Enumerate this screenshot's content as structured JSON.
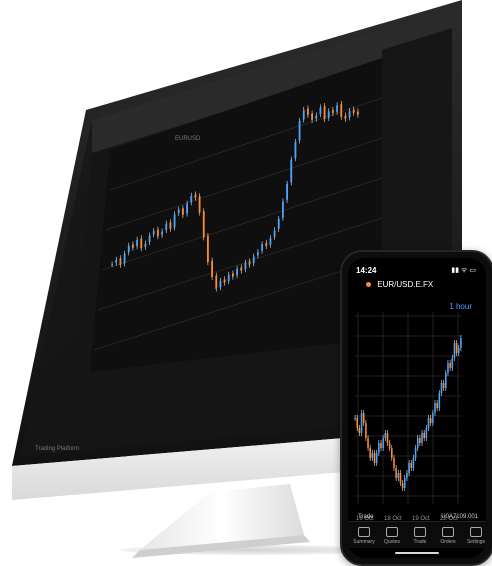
{
  "desktop": {
    "app": {
      "instrument_label": "EURUSD",
      "footer": "Trading Platform"
    }
  },
  "phone": {
    "time": "14:24",
    "instrument": "EUR/USD.E.FX",
    "interval": "1 hour",
    "trade_label": "Trade",
    "account_id": "U0A7109.001",
    "tabs": [
      "Summary",
      "Quotes",
      "Trade",
      "Orders",
      "Settings"
    ],
    "x_labels": [
      "16 Oct",
      "18 Oct",
      "19 Oct",
      "22 Oct"
    ]
  },
  "colors": {
    "up": "#4aa3ff",
    "down": "#ff8a2b",
    "neutral": "#e7e7e7"
  },
  "chart_data": [
    {
      "type": "line",
      "title": "",
      "x": [
        0,
        1,
        2,
        3,
        4,
        5,
        6,
        7,
        8,
        9,
        10,
        11,
        12,
        13,
        14,
        15,
        16,
        17,
        18,
        19,
        20,
        21,
        22,
        23,
        24,
        25,
        26,
        27,
        28,
        29,
        30,
        31,
        32,
        33,
        34,
        35,
        36,
        37,
        38,
        39,
        40,
        41,
        42,
        43,
        44,
        45,
        46,
        47,
        48,
        49,
        50,
        51,
        52,
        53,
        54,
        55,
        56,
        57,
        58,
        59
      ],
      "series": [
        {
          "values": [
            1.161,
            1.162,
            1.16,
            1.163,
            1.165,
            1.164,
            1.166,
            1.163,
            1.164,
            1.166,
            1.167,
            1.165,
            1.166,
            1.168,
            1.166,
            1.17,
            1.171,
            1.169,
            1.172,
            1.174,
            1.173,
            1.168,
            1.16,
            1.152,
            1.147,
            1.143,
            1.145,
            1.144,
            1.146,
            1.145,
            1.147,
            1.146,
            1.148,
            1.147,
            1.149,
            1.15,
            1.152,
            1.151,
            1.153,
            1.155,
            1.158,
            1.163,
            1.168,
            1.175,
            1.18,
            1.186,
            1.189,
            1.187,
            1.185,
            1.186,
            1.188,
            1.184,
            1.186,
            1.185,
            1.187,
            1.183,
            1.182,
            1.184,
            1.183,
            1.182
          ]
        }
      ]
    },
    {
      "type": "line",
      "title": "",
      "x": [
        0,
        1,
        2,
        3,
        4,
        5,
        6,
        7,
        8,
        9,
        10,
        11,
        12,
        13,
        14,
        15,
        16,
        17,
        18,
        19,
        20,
        21,
        22,
        23,
        24,
        25,
        26,
        27,
        28,
        29,
        30,
        31,
        32,
        33,
        34,
        35,
        36,
        37,
        38,
        39,
        40,
        41,
        42,
        43,
        44,
        45,
        46,
        47,
        48,
        49
      ],
      "series": [
        {
          "values": [
            1.155,
            1.153,
            1.152,
            1.156,
            1.154,
            1.151,
            1.149,
            1.147,
            1.148,
            1.146,
            1.148,
            1.15,
            1.149,
            1.151,
            1.152,
            1.15,
            1.149,
            1.147,
            1.145,
            1.143,
            1.144,
            1.142,
            1.141,
            1.143,
            1.144,
            1.146,
            1.145,
            1.147,
            1.149,
            1.151,
            1.15,
            1.152,
            1.151,
            1.153,
            1.155,
            1.154,
            1.156,
            1.158,
            1.157,
            1.16,
            1.162,
            1.161,
            1.164,
            1.166,
            1.165,
            1.167,
            1.17,
            1.168,
            1.169,
            1.171
          ]
        }
      ]
    }
  ]
}
